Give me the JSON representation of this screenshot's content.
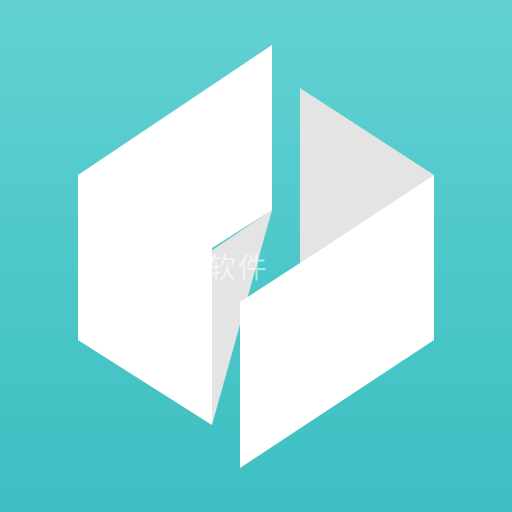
{
  "app_icon": {
    "watermark_text": "五九软件",
    "background_colors": [
      "#63d1d3",
      "#3dbfc1"
    ],
    "panel_color": "#ffffff",
    "shadow_color": "#e4e4e4",
    "logo_icon": "hexagon-split-logo-icon"
  }
}
